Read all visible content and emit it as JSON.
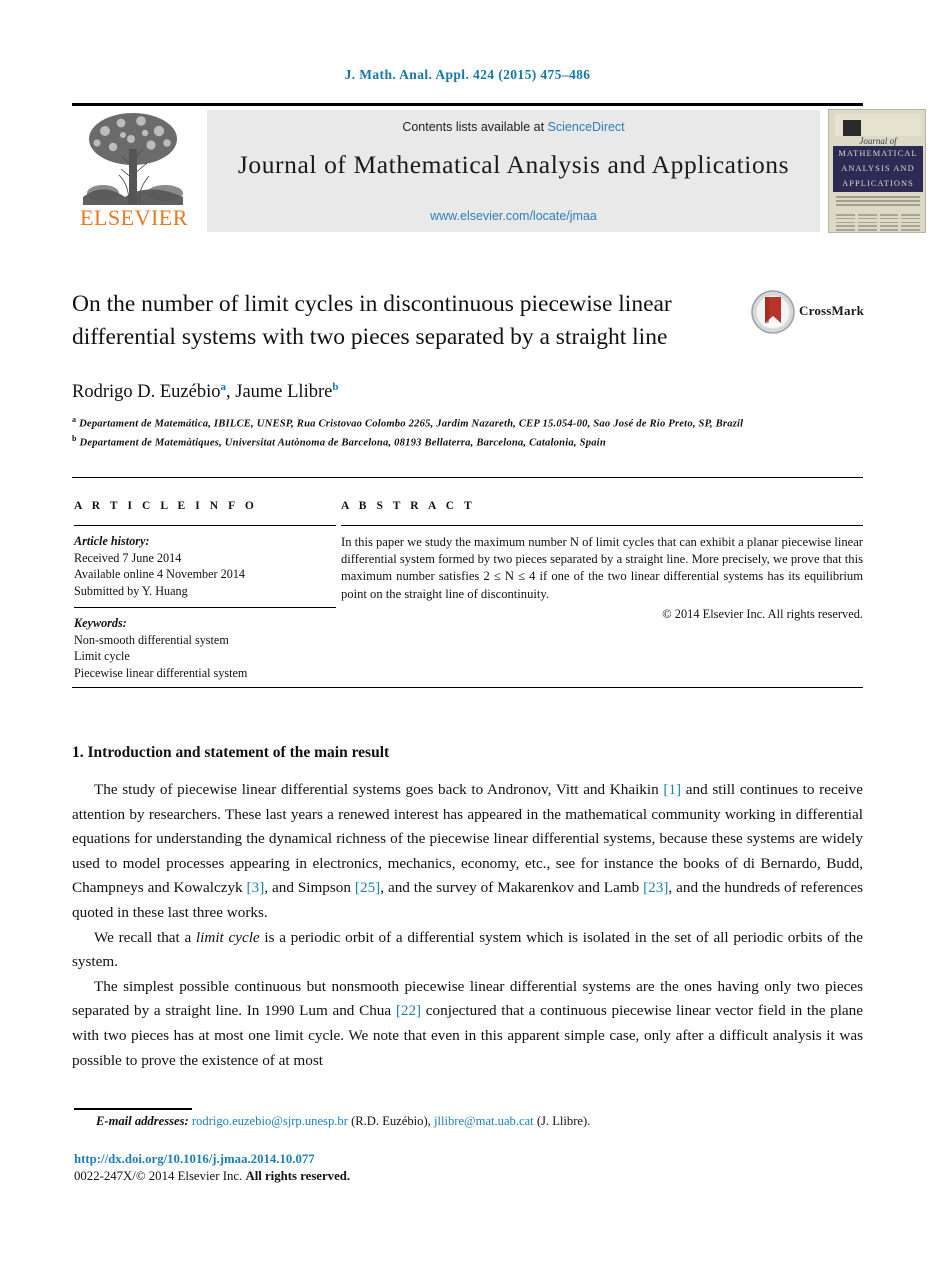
{
  "running_head": "J. Math. Anal. Appl. 424 (2015) 475–486",
  "masthead": {
    "contents_prefix": "Contents lists available at",
    "contents_link": "ScienceDirect",
    "journal_title": "Journal of Mathematical Analysis and Applications",
    "journal_url": "www.elsevier.com/locate/jmaa",
    "publisher_wordmark": "ELSEVIER",
    "cover": {
      "script_line": "Journal of",
      "band_line1": "MATHEMATICAL",
      "band_line2": "ANALYSIS AND",
      "band_line3": "APPLICATIONS"
    }
  },
  "article": {
    "title": "On the number of limit cycles in discontinuous piecewise linear differential systems with two pieces separated by a straight line",
    "crossmark_label": "CrossMark",
    "authors_text": "Rodrigo D. Euzébio",
    "author1": "Rodrigo D. Euzébio",
    "author1_mark": "a",
    "author_sep": ", ",
    "author2": "Jaume Llibre",
    "author2_mark": "b",
    "affiliation_a_mark": "a",
    "affiliation_a": "Departament de Matemática, IBILCE, UNESP, Rua Cristovao Colombo 2265, Jardim Nazareth, CEP 15.054-00, Sao José de Rio Preto, SP, Brazil",
    "affiliation_b_mark": "b",
    "affiliation_b": "Departament de Matemàtiques, Universitat Autònoma de Barcelona, 08193 Bellaterra, Barcelona, Catalonia, Spain"
  },
  "info": {
    "heading": "A R T I C L E   I N F O",
    "history_label": "Article history:",
    "history": [
      "Received 7 June 2014",
      "Available online 4 November 2014",
      "Submitted by Y. Huang"
    ],
    "keywords_label": "Keywords:",
    "keywords": [
      "Non-smooth differential system",
      "Limit cycle",
      "Piecewise linear differential system"
    ]
  },
  "abstract": {
    "heading": "A B S T R A C T",
    "text": "In this paper we study the maximum number N of limit cycles that can exhibit a planar piecewise linear differential system formed by two pieces separated by a straight line. More precisely, we prove that this maximum number satisfies 2 ≤ N ≤ 4 if one of the two linear differential systems has its equilibrium point on the straight line of discontinuity.",
    "copyright": "© 2014 Elsevier Inc. All rights reserved."
  },
  "body": {
    "section_heading": "1. Introduction and statement of the main result",
    "paragraph1_a": "The study of piecewise linear differential systems goes back to Andronov, Vitt and Khaikin ",
    "paragraph1_ref1": "[1]",
    "paragraph1_b": " and still continues to receive attention by researchers. These last years a renewed interest has appeared in the mathematical community working in differential equations for understanding the dynamical richness of the piecewise linear differential systems, because these systems are widely used to model processes appearing in electronics, mechanics, economy, etc., see for instance the books of di Bernardo, Budd, Champneys and Kowalczyk ",
    "paragraph1_ref2": "[3]",
    "paragraph1_c": ", and Simpson ",
    "paragraph1_ref3": "[25]",
    "paragraph1_d": ", and the survey of Makarenkov and Lamb ",
    "paragraph1_ref4": "[23]",
    "paragraph1_e": ", and the hundreds of references quoted in these last three works.",
    "paragraph2_a": "We recall that a ",
    "paragraph2_em": "limit cycle",
    "paragraph2_b": " is a periodic orbit of a differential system which is isolated in the set of all periodic orbits of the system.",
    "paragraph3_a": "The simplest possible continuous but nonsmooth piecewise linear differential systems are the ones having only two pieces separated by a straight line. In 1990 Lum and Chua ",
    "paragraph3_ref1": "[22]",
    "paragraph3_b": " conjectured that a continuous piecewise linear vector field in the plane with two pieces has at most one limit cycle. We note that even in this apparent simple case, only after a difficult analysis it was possible to prove the existence of at most"
  },
  "footer": {
    "emails_label": "E-mail addresses:",
    "email1": "rodrigo.euzebio@sjrp.unesp.br",
    "email1_owner": "(R.D. Euzébio),",
    "email2": "jllibre@mat.uab.cat",
    "email2_owner": "(J. Llibre).",
    "doi": "http://dx.doi.org/10.1016/j.jmaa.2014.10.077",
    "issn_prefix": "0022-247X/",
    "issn_rest": "© 2014 Elsevier Inc. ",
    "issn_bold": "All rights reserved."
  },
  "colors": {
    "link": "#2c7fb8",
    "ref": "#1b7fb5",
    "runhead": "#1477a8",
    "elsevier_orange": "#e87722",
    "cover_navy": "#2d2a55",
    "crossmark_red": "#b8342a"
  }
}
